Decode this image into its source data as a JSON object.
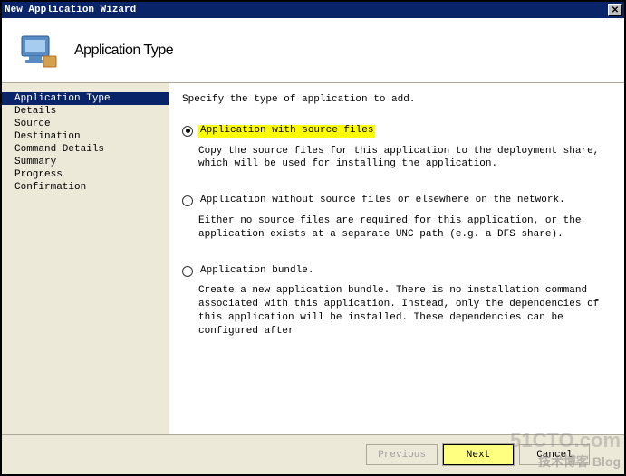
{
  "window": {
    "title": "New Application Wizard"
  },
  "header": {
    "title": "Application Type"
  },
  "sidebar": {
    "items": [
      {
        "label": "Application Type",
        "active": true
      },
      {
        "label": "Details",
        "active": false
      },
      {
        "label": "Source",
        "active": false
      },
      {
        "label": "Destination",
        "active": false
      },
      {
        "label": "Command Details",
        "active": false
      },
      {
        "label": "Summary",
        "active": false
      },
      {
        "label": "Progress",
        "active": false
      },
      {
        "label": "Confirmation",
        "active": false
      }
    ]
  },
  "main": {
    "instruction": "Specify the type of application to add.",
    "options": [
      {
        "label": "Application with source files",
        "checked": true,
        "highlight": true,
        "description": "Copy the source files for this application to the deployment share, which will be used for installing the application."
      },
      {
        "label": "Application without source files or elsewhere on the network.",
        "checked": false,
        "highlight": false,
        "description": "Either no source files are required for this application, or the application exists at a separate UNC path (e.g. a DFS share)."
      },
      {
        "label": "Application bundle.",
        "checked": false,
        "highlight": false,
        "description": "Create a new application bundle.  There is no installation command associated with this application.  Instead, only the dependencies of this application will be installed.  These dependencies can be configured after"
      }
    ]
  },
  "footer": {
    "previous": "Previous",
    "next": "Next",
    "cancel": "Cancel"
  },
  "watermark": {
    "line1": "51CTO.com",
    "line2": "技术博客 Blog"
  }
}
